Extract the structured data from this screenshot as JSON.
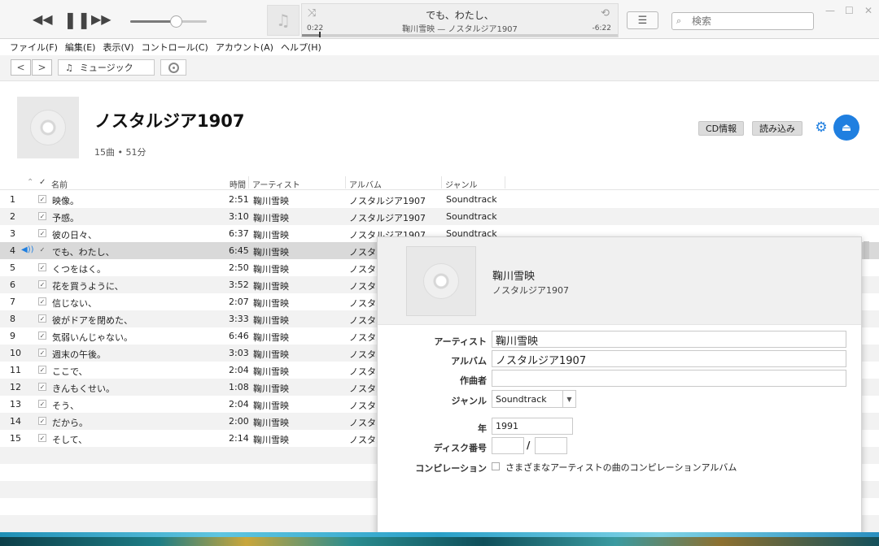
{
  "player": {
    "rewind_icon": "rewind-icon",
    "pause_icon": "pause-icon",
    "forward_icon": "fast-forward-icon",
    "volume_level": 0.6,
    "now_playing_title": "でも、わたし、",
    "now_playing_sub": "鞠川雪映 — ノスタルジア1907",
    "elapsed": "0:22",
    "remaining": "-6:22",
    "progress": 0.054,
    "search_placeholder": "検索"
  },
  "menu": [
    "ファイル(F)",
    "編集(E)",
    "表示(V)",
    "コントロール(C)",
    "アカウント(A)",
    "ヘルプ(H)"
  ],
  "toolbar": {
    "source": "ミュージック"
  },
  "album": {
    "title": "ノスタルジア1907",
    "meta": "15曲 • 51分",
    "cd_info": "CD情報",
    "import": "読み込み"
  },
  "columns": {
    "name": "名前",
    "time": "時間",
    "artist": "アーティスト",
    "album": "アルバム",
    "genre": "ジャンル"
  },
  "tracks": [
    {
      "num": "1",
      "name": "映像。",
      "time": "2:51",
      "artist": "鞠川雪映",
      "album": "ノスタルジア1907",
      "genre": "Soundtrack"
    },
    {
      "num": "2",
      "name": "予感。",
      "time": "3:10",
      "artist": "鞠川雪映",
      "album": "ノスタルジア1907",
      "genre": "Soundtrack"
    },
    {
      "num": "3",
      "name": "彼の日々、",
      "time": "6:37",
      "artist": "鞠川雪映",
      "album": "ノスタルジア1907",
      "genre": "Soundtrack"
    },
    {
      "num": "4",
      "name": "でも、わたし、",
      "time": "6:45",
      "artist": "鞠川雪映",
      "album": "ノスタル",
      "genre": ""
    },
    {
      "num": "5",
      "name": "くつをはく。",
      "time": "2:50",
      "artist": "鞠川雪映",
      "album": "ノスタル",
      "genre": ""
    },
    {
      "num": "6",
      "name": "花を買うように、",
      "time": "3:52",
      "artist": "鞠川雪映",
      "album": "ノスタル",
      "genre": ""
    },
    {
      "num": "7",
      "name": "信じない、",
      "time": "2:07",
      "artist": "鞠川雪映",
      "album": "ノスタル",
      "genre": ""
    },
    {
      "num": "8",
      "name": "彼がドアを閉めた、",
      "time": "3:33",
      "artist": "鞠川雪映",
      "album": "ノスタル",
      "genre": ""
    },
    {
      "num": "9",
      "name": "気弱いんじゃない。",
      "time": "6:46",
      "artist": "鞠川雪映",
      "album": "ノスタル",
      "genre": ""
    },
    {
      "num": "10",
      "name": "週末の午後。",
      "time": "3:03",
      "artist": "鞠川雪映",
      "album": "ノスタル",
      "genre": ""
    },
    {
      "num": "11",
      "name": "ここで、",
      "time": "2:04",
      "artist": "鞠川雪映",
      "album": "ノスタル",
      "genre": ""
    },
    {
      "num": "12",
      "name": "きんもくせい。",
      "time": "1:08",
      "artist": "鞠川雪映",
      "album": "ノスタル",
      "genre": ""
    },
    {
      "num": "13",
      "name": "そう、",
      "time": "2:04",
      "artist": "鞠川雪映",
      "album": "ノスタル",
      "genre": ""
    },
    {
      "num": "14",
      "name": "だから。",
      "time": "2:00",
      "artist": "鞠川雪映",
      "album": "ノスタル",
      "genre": ""
    },
    {
      "num": "15",
      "name": "そして、",
      "time": "2:14",
      "artist": "鞠川雪映",
      "album": "ノスタル",
      "genre": ""
    }
  ],
  "info": {
    "artist_header": "鞠川雪映",
    "album_header": "ノスタルジア1907",
    "labels": {
      "artist": "アーティスト",
      "album": "アルバム",
      "composer": "作曲者",
      "genre": "ジャンル",
      "year": "年",
      "disc": "ディスク番号",
      "compilation": "コンピレーション"
    },
    "artist": "鞠川雪映",
    "album": "ノスタルジア1907",
    "composer": "",
    "genre": "Soundtrack",
    "year": "1991",
    "disc_slash": "/",
    "compilation_text": "さまざまなアーティストの曲のコンピレーションアルバム"
  },
  "colors": {
    "accent": "#1f7fe0",
    "playing_row": "#d9d9d9",
    "alt_row": "#f2f2f2"
  }
}
